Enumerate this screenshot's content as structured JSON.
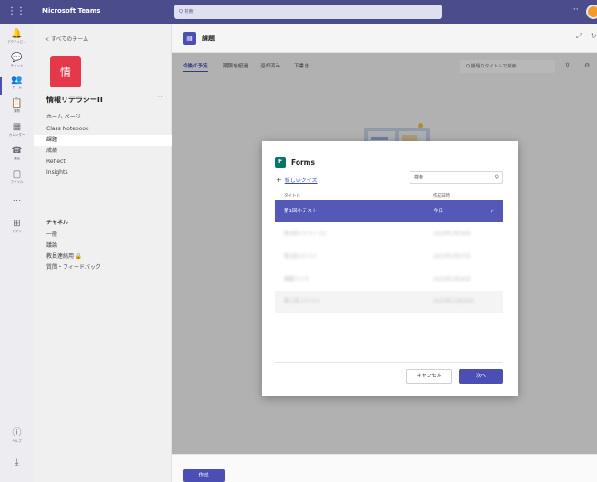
{
  "topbar": {
    "app_title": "Microsoft Teams",
    "search_placeholder": "Q 検索",
    "more_label": "···"
  },
  "rail": {
    "items": [
      {
        "label": "アクティビ...",
        "icon": "bell-icon"
      },
      {
        "label": "チャット",
        "icon": "chat-icon"
      },
      {
        "label": "チーム",
        "icon": "teams-icon"
      },
      {
        "label": "課題",
        "icon": "assignments-icon"
      },
      {
        "label": "カレンダー",
        "icon": "calendar-icon"
      },
      {
        "label": "通話",
        "icon": "phone-icon"
      },
      {
        "label": "ファイル",
        "icon": "file-icon"
      },
      {
        "label": "···",
        "icon": "more-icon"
      },
      {
        "label": "アプリ",
        "icon": "apps-icon"
      },
      {
        "label": "ヘルプ",
        "icon": "help-icon"
      },
      {
        "label": "",
        "icon": "download-icon"
      }
    ]
  },
  "sidebar": {
    "back_label": "< すべてのチーム",
    "team_tile": "情",
    "team_name": "情報リテラシーII",
    "team_more": "···",
    "nav": [
      "ホーム ページ",
      "Class Notebook",
      "課題",
      "成績",
      "Reflect",
      "Insights"
    ],
    "selected_nav": "課題",
    "channels_header": "チャネル",
    "channels": [
      "一般",
      "議論",
      "教員連絡用 🔒",
      "質問・フィードバック"
    ]
  },
  "main": {
    "title": "課題",
    "tabs": [
      "今後の予定",
      "期限を超過",
      "返却済み",
      "下書き"
    ],
    "active_tab": "今後の予定",
    "search_placeholder": "Q 課題のタイトルで検索",
    "create_label": "作成"
  },
  "dialog": {
    "title": "Forms",
    "logo_letter": "F",
    "new_quiz_label": "新しいクイズ",
    "search_placeholder": "検索",
    "columns": [
      "タイトル",
      "作成日時"
    ],
    "rows": [
      {
        "title": "第1回小テスト",
        "date": "今日",
        "selected": true
      },
      {
        "title": "第1回小テスト (2)",
        "date": "2023年2月28日",
        "selected": false
      },
      {
        "title": "第1回小テスト",
        "date": "2023年2月27日",
        "selected": false
      },
      {
        "title": "模擬クイズ",
        "date": "2023年2月26日",
        "selected": false
      },
      {
        "title": "第三回 小テスト",
        "date": "2022年11月30日",
        "selected": false
      }
    ],
    "cancel_label": "キャンセル",
    "next_label": "次へ"
  },
  "colors": {
    "topbar": "#4b4c8c",
    "accent": "#4b4fb4",
    "team_tile": "#e53848",
    "forms_green": "#077568"
  }
}
